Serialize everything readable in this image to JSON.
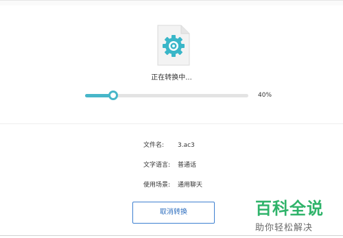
{
  "conversion": {
    "status_text": "正在转换中...",
    "progress": 0.4,
    "progress_label": "40%",
    "accent_color": "#47b6c9"
  },
  "file_info": [
    {
      "label": "文件名:",
      "value": "3.ac3"
    },
    {
      "label": "文字语言:",
      "value": "普通话"
    },
    {
      "label": "使用场景:",
      "value": "通用聊天"
    }
  ],
  "actions": {
    "cancel_label": "取消转换"
  },
  "icon": {
    "name": "file-gear-icon"
  },
  "watermark": {
    "title": "百科全说",
    "subtitle": "助你轻松解决",
    "color": "#2fb36a"
  }
}
